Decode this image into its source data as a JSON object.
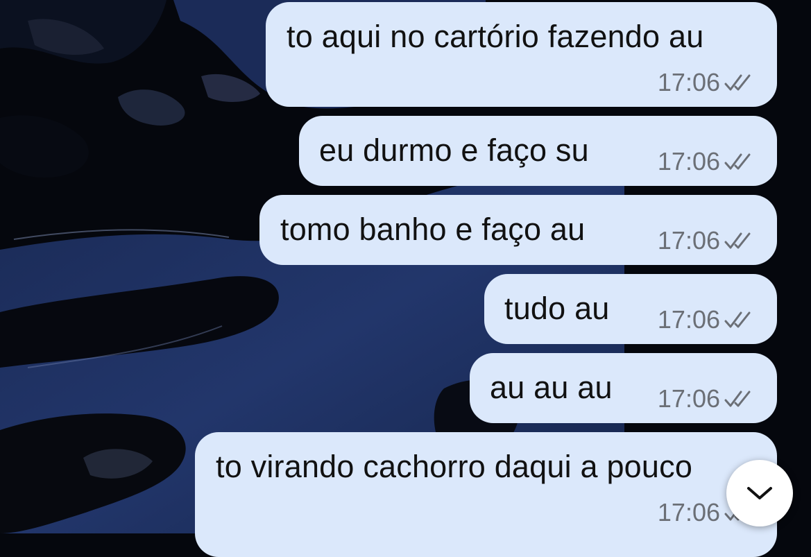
{
  "chat": {
    "messages": [
      {
        "text": "to aqui no cartório fazendo au",
        "time": "17:06",
        "status_icon": "double-check-icon"
      },
      {
        "text": "eu durmo e faço su",
        "time": "17:06",
        "status_icon": "double-check-icon"
      },
      {
        "text": "tomo banho e faço au",
        "time": "17:06",
        "status_icon": "double-check-icon"
      },
      {
        "text": "tudo au",
        "time": "17:06",
        "status_icon": "double-check-icon"
      },
      {
        "text": "au au au",
        "time": "17:06",
        "status_icon": "double-check-icon"
      },
      {
        "text": "to virando cachorro daqui a pouco",
        "time": "17:06",
        "status_icon": "double-check-icon"
      }
    ],
    "scroll_down_icon": "chevron-down-icon"
  },
  "colors": {
    "bubble_background": "#dbe8fb",
    "message_text": "#111111",
    "timestamp": "#6b6f76",
    "wallpaper_dark": "#05070d",
    "wallpaper_blue": "#1c2e5c"
  }
}
